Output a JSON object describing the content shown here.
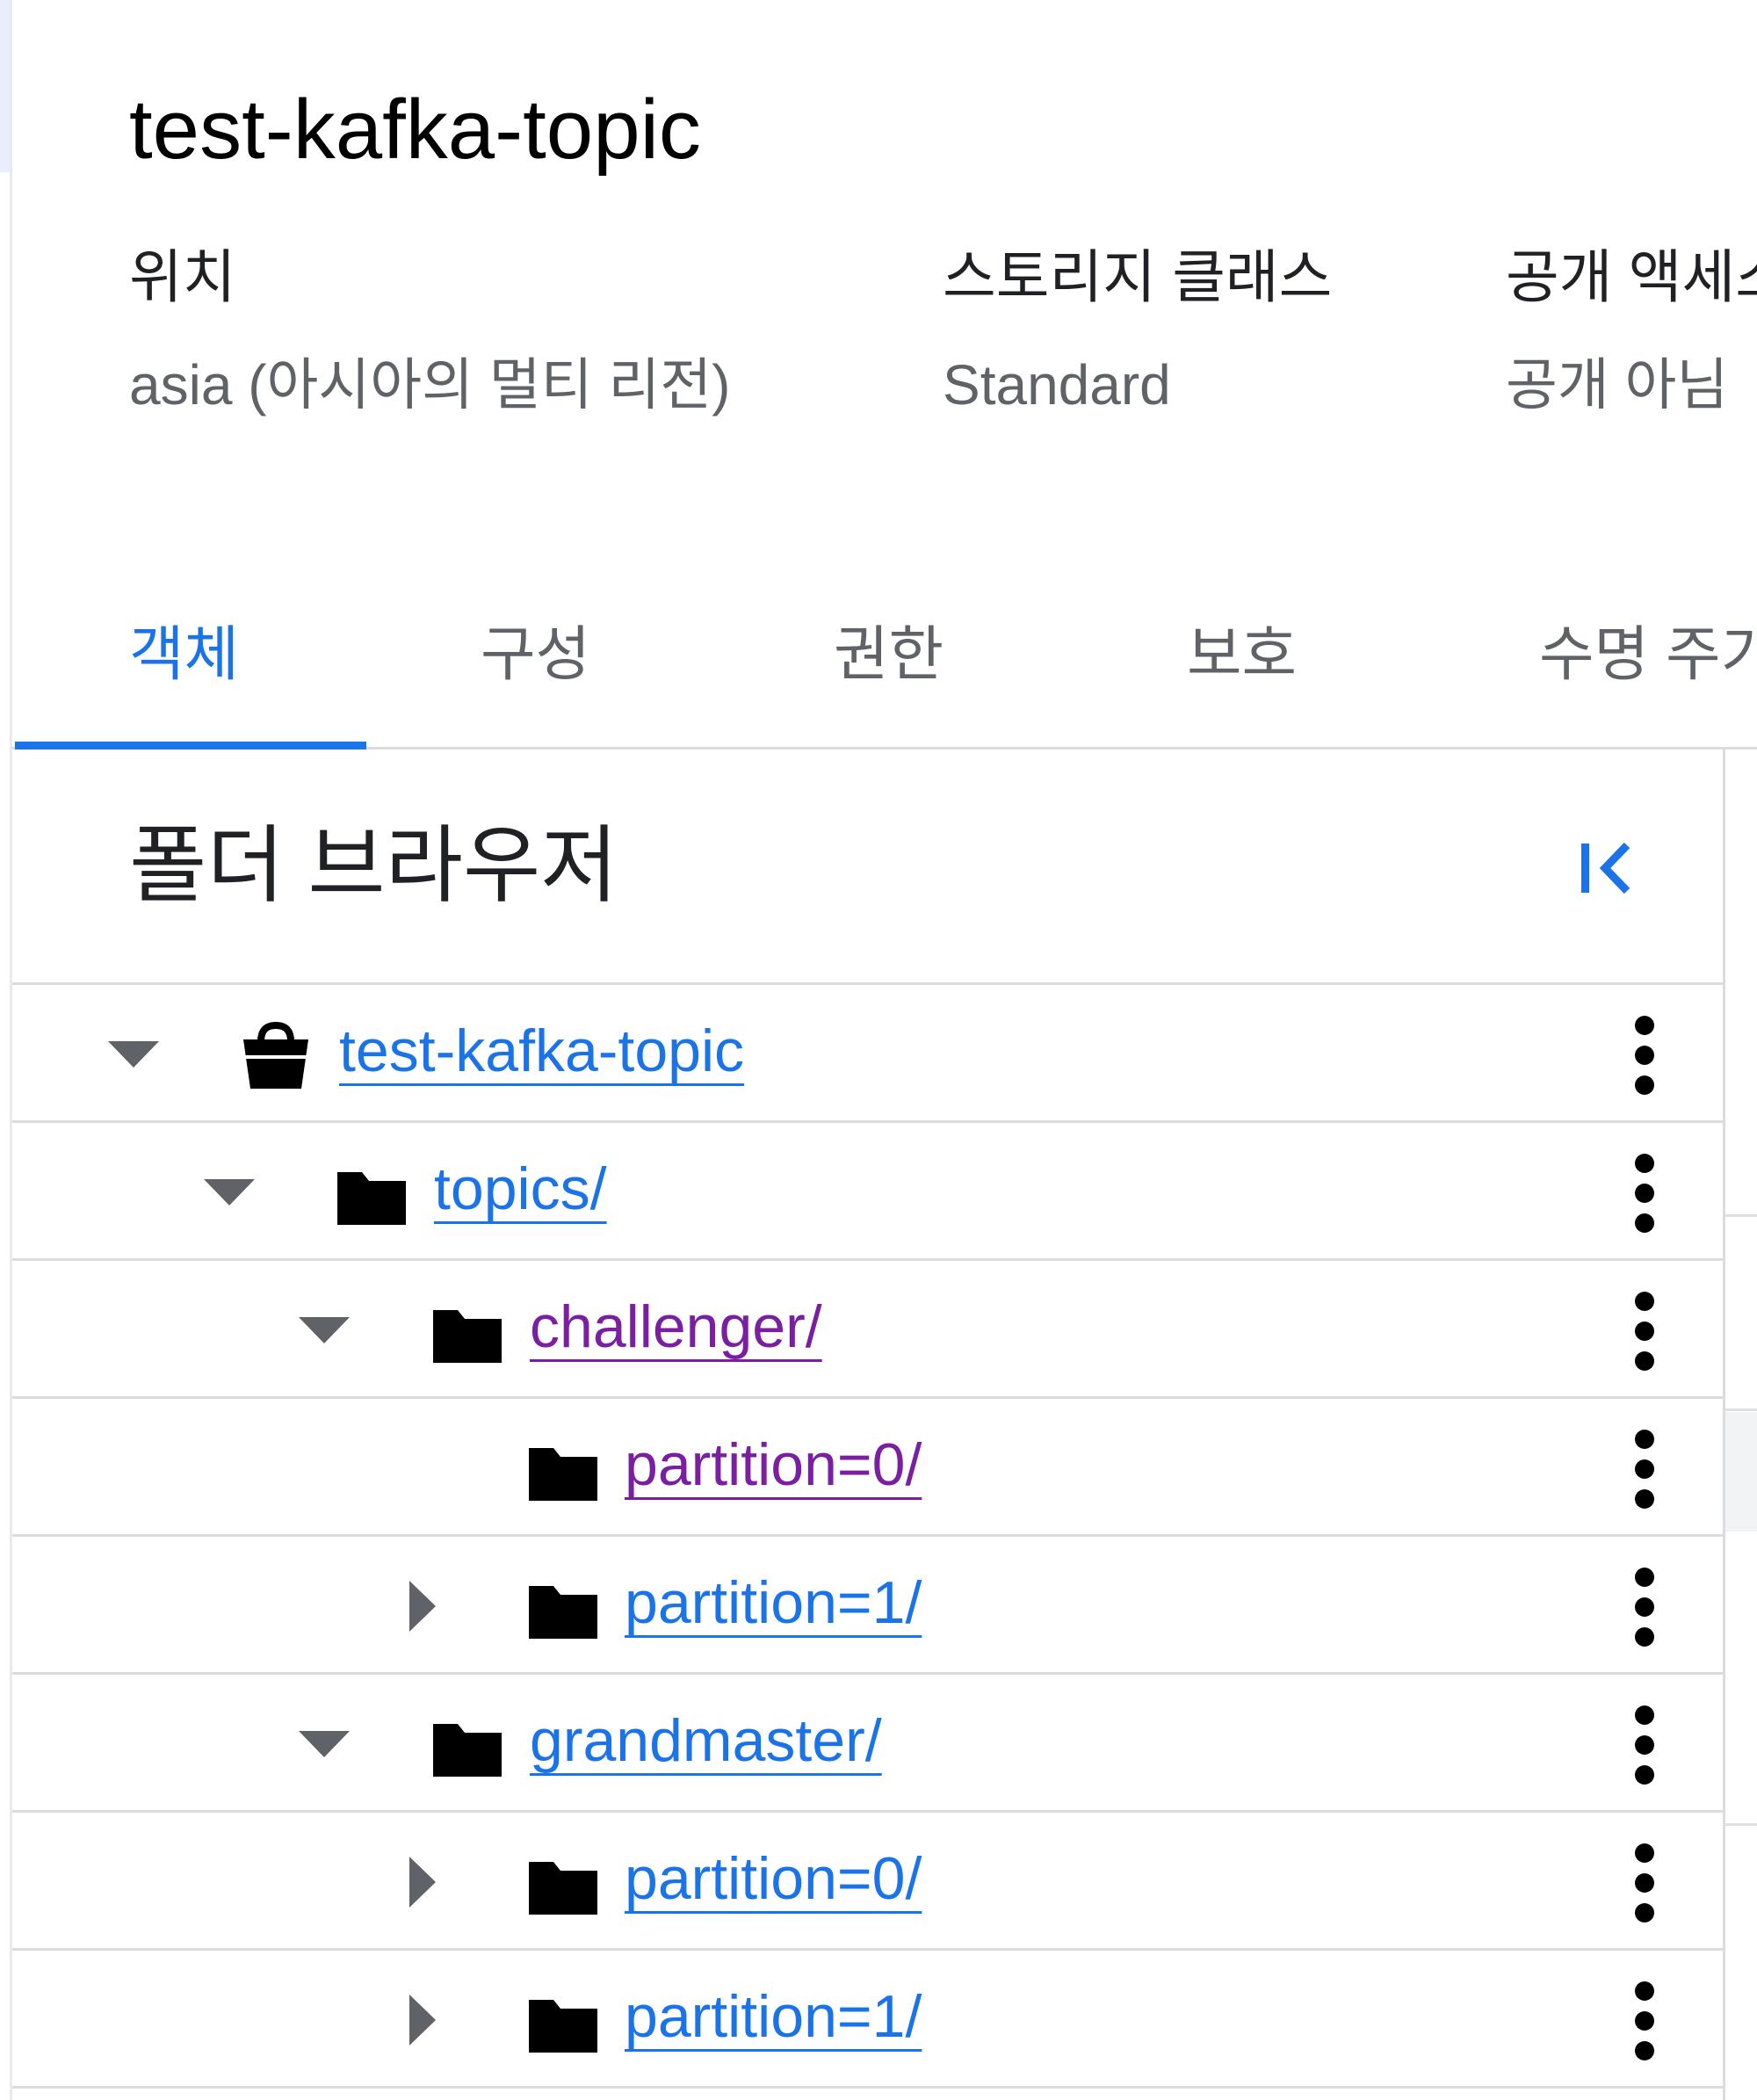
{
  "bucket": {
    "title": "test-kafka-topic"
  },
  "meta": {
    "location_label": "위치",
    "location_value": "asia (아시아의 멀티 리전)",
    "storage_class_label": "스토리지 클래스",
    "storage_class_value": "Standard",
    "public_access_label": "공개 액세스",
    "public_access_value": "공개 아님"
  },
  "tabs": [
    {
      "label": "객체",
      "active": true
    },
    {
      "label": "구성",
      "active": false
    },
    {
      "label": "권한",
      "active": false
    },
    {
      "label": "보호",
      "active": false
    },
    {
      "label": "수명 주기",
      "active": false
    }
  ],
  "folder_browser": {
    "title": "폴더 브라우저",
    "collapse_icon": "collapse-left-icon",
    "more_icon": "more-vert-icon",
    "link_color": "#1a73e8",
    "visited_link_color": "#7b1fa2",
    "accent_color": "#1a73e8",
    "nodes": [
      {
        "label": "test-kafka-topic",
        "type": "bucket",
        "toggle": "expanded",
        "visited": false
      },
      {
        "label": "topics/",
        "type": "folder",
        "toggle": "expanded",
        "visited": false
      },
      {
        "label": "challenger/",
        "type": "folder",
        "toggle": "expanded",
        "visited": true
      },
      {
        "label": "partition=0/",
        "type": "folder",
        "toggle": "none",
        "visited": true
      },
      {
        "label": "partition=1/",
        "type": "folder",
        "toggle": "collapsed",
        "visited": false
      },
      {
        "label": "grandmaster/",
        "type": "folder",
        "toggle": "expanded",
        "visited": false
      },
      {
        "label": "partition=0/",
        "type": "folder",
        "toggle": "collapsed",
        "visited": false
      },
      {
        "label": "partition=1/",
        "type": "folder",
        "toggle": "collapsed",
        "visited": false
      }
    ]
  }
}
